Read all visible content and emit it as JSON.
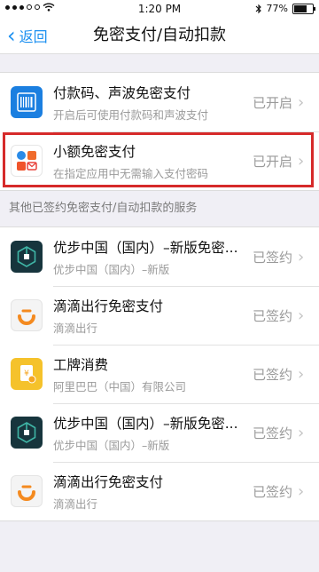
{
  "status_bar": {
    "time": "1:20 PM",
    "battery": "77%",
    "battery_level": 0.77
  },
  "nav": {
    "back_label": "返回",
    "title": "免密支付/自动扣款"
  },
  "main_items": [
    {
      "icon": "barcode-icon",
      "title": "付款码、声波免密支付",
      "subtitle": "开启后可使用付款码和声波支付",
      "status": "已开启"
    },
    {
      "icon": "small-payment-icon",
      "title": "小额免密支付",
      "subtitle": "在指定应用中无需输入支付密码",
      "status": "已开启"
    }
  ],
  "section_header": "其他已签约免密支付/自动扣款的服务",
  "services": [
    {
      "icon": "uber-icon",
      "title": "优步中国（国内）–新版免密...",
      "subtitle": "优步中国（国内）–新版",
      "status": "已签约"
    },
    {
      "icon": "didi-icon",
      "title": "滴滴出行免密支付",
      "subtitle": "滴滴出行",
      "status": "已签约"
    },
    {
      "icon": "gongpai-icon",
      "title": "工牌消费",
      "subtitle": "阿里巴巴（中国）有限公司",
      "status": "已签约"
    },
    {
      "icon": "uber-icon",
      "title": "优步中国（国内）–新版免密...",
      "subtitle": "优步中国（国内）–新版",
      "status": "已签约"
    },
    {
      "icon": "didi-icon",
      "title": "滴滴出行免密支付",
      "subtitle": "滴滴出行",
      "status": "已签约"
    }
  ],
  "colors": {
    "accent": "#1a8ff0",
    "highlight": "#d62a2a",
    "background": "#f0eff5"
  }
}
